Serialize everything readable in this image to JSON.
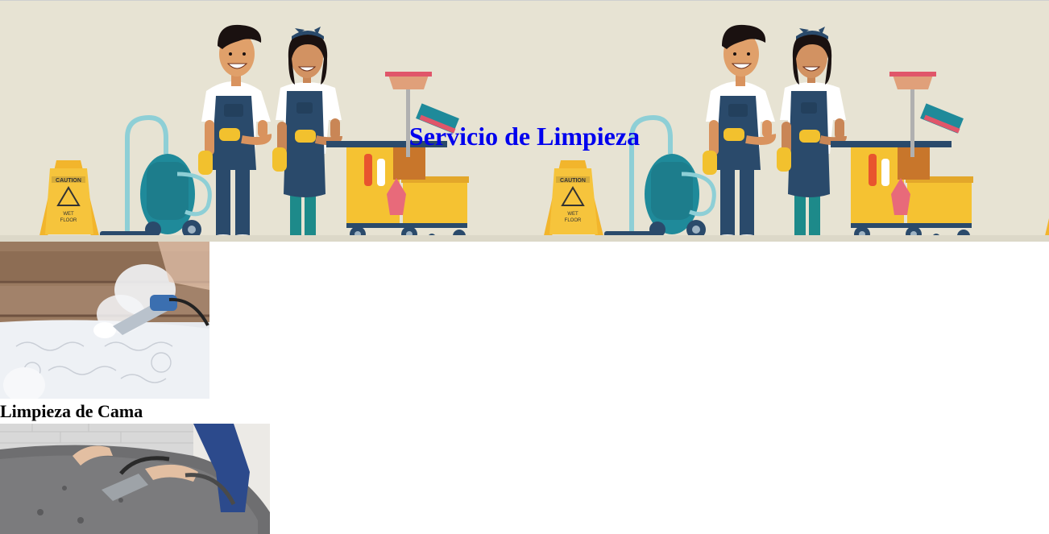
{
  "banner": {
    "title": "Servicio de Limpieza",
    "sign_text": [
      "CAUTION",
      "WET",
      "FLOOR"
    ]
  },
  "services": [
    {
      "title": "Limpieza de Cama",
      "image": "steam-cleaning-mattress-photo"
    },
    {
      "title": "",
      "image": "vacuuming-sofa-photo"
    }
  ],
  "colors": {
    "title": "#0000ee",
    "banner_bg": "#e7e3d3",
    "overall_navy": "#2a4a6b",
    "glove_yellow": "#f2c12e",
    "vacuum_teal": "#1f8a9a",
    "cart_yellow": "#f5c232"
  }
}
